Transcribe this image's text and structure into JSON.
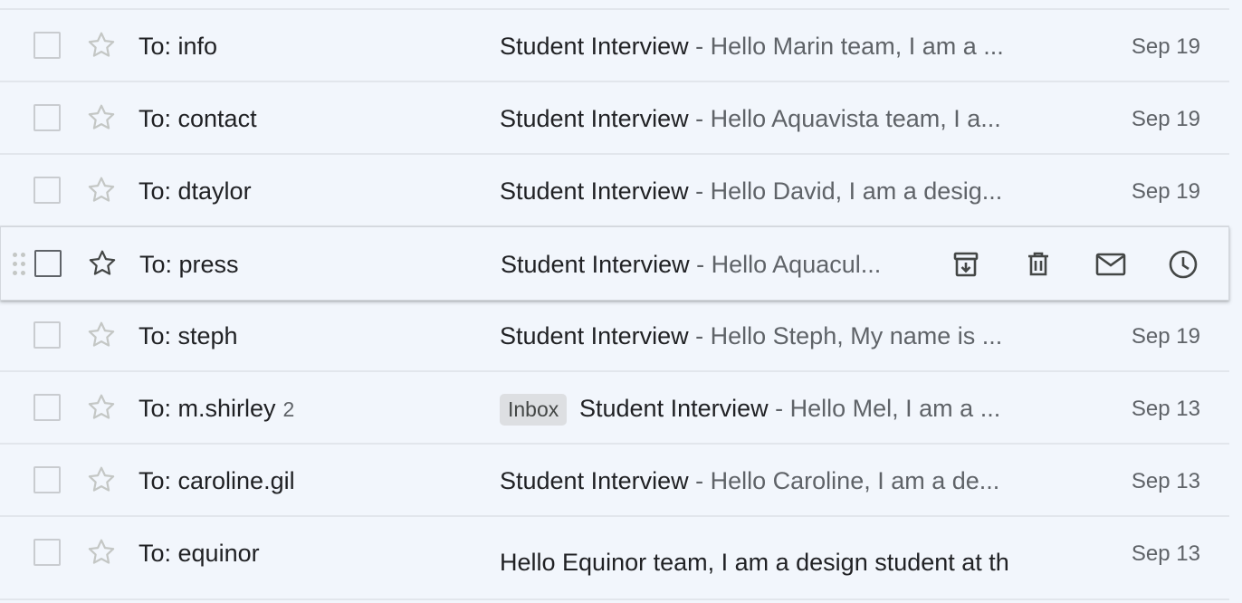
{
  "rows": [
    {
      "sender": "To: info",
      "count": "",
      "label": "",
      "subject": "Student Interview",
      "separator": " - ",
      "snippet": "Hello Marin team, I am a ...",
      "date": "Sep 19"
    },
    {
      "sender": "To: contact",
      "count": "",
      "label": "",
      "subject": "Student Interview",
      "separator": " - ",
      "snippet": "Hello Aquavista team, I a...",
      "date": "Sep 19"
    },
    {
      "sender": "To: dtaylor",
      "count": "",
      "label": "",
      "subject": "Student Interview",
      "separator": " - ",
      "snippet": "Hello David, I am a desig...",
      "date": "Sep 19"
    },
    {
      "sender": "To: press",
      "count": "",
      "label": "",
      "subject": "Student Interview",
      "separator": " - ",
      "snippet": "Hello Aquacul...",
      "date": ""
    },
    {
      "sender": "To: steph",
      "count": "",
      "label": "",
      "subject": "Student Interview",
      "separator": " - ",
      "snippet": "Hello Steph, My name is ...",
      "date": "Sep 19"
    },
    {
      "sender": "To: m.shirley",
      "count": "2",
      "label": "Inbox",
      "subject": "Student Interview",
      "separator": " - ",
      "snippet": "Hello Mel, I am a ...",
      "date": "Sep 13"
    },
    {
      "sender": "To: caroline.gil",
      "count": "",
      "label": "",
      "subject": "Student Interview",
      "separator": " - ",
      "snippet": "Hello Caroline, I am a de...",
      "date": "Sep 13"
    },
    {
      "sender": "To: equinor",
      "count": "",
      "label": "",
      "subject": "",
      "separator": "",
      "snippet": "Hello Equinor team, I am a design student at th",
      "date": "Sep 13"
    }
  ],
  "hover_actions": [
    {
      "icon": "archive-icon"
    },
    {
      "icon": "delete-icon"
    },
    {
      "icon": "mark-unread-icon"
    },
    {
      "icon": "snooze-icon"
    }
  ],
  "colors": {
    "background": "#f2f6fc",
    "divider": "#e2e6ec",
    "text_primary": "#202124",
    "text_secondary": "#5f6368",
    "label_chip": "#dddfe2"
  }
}
